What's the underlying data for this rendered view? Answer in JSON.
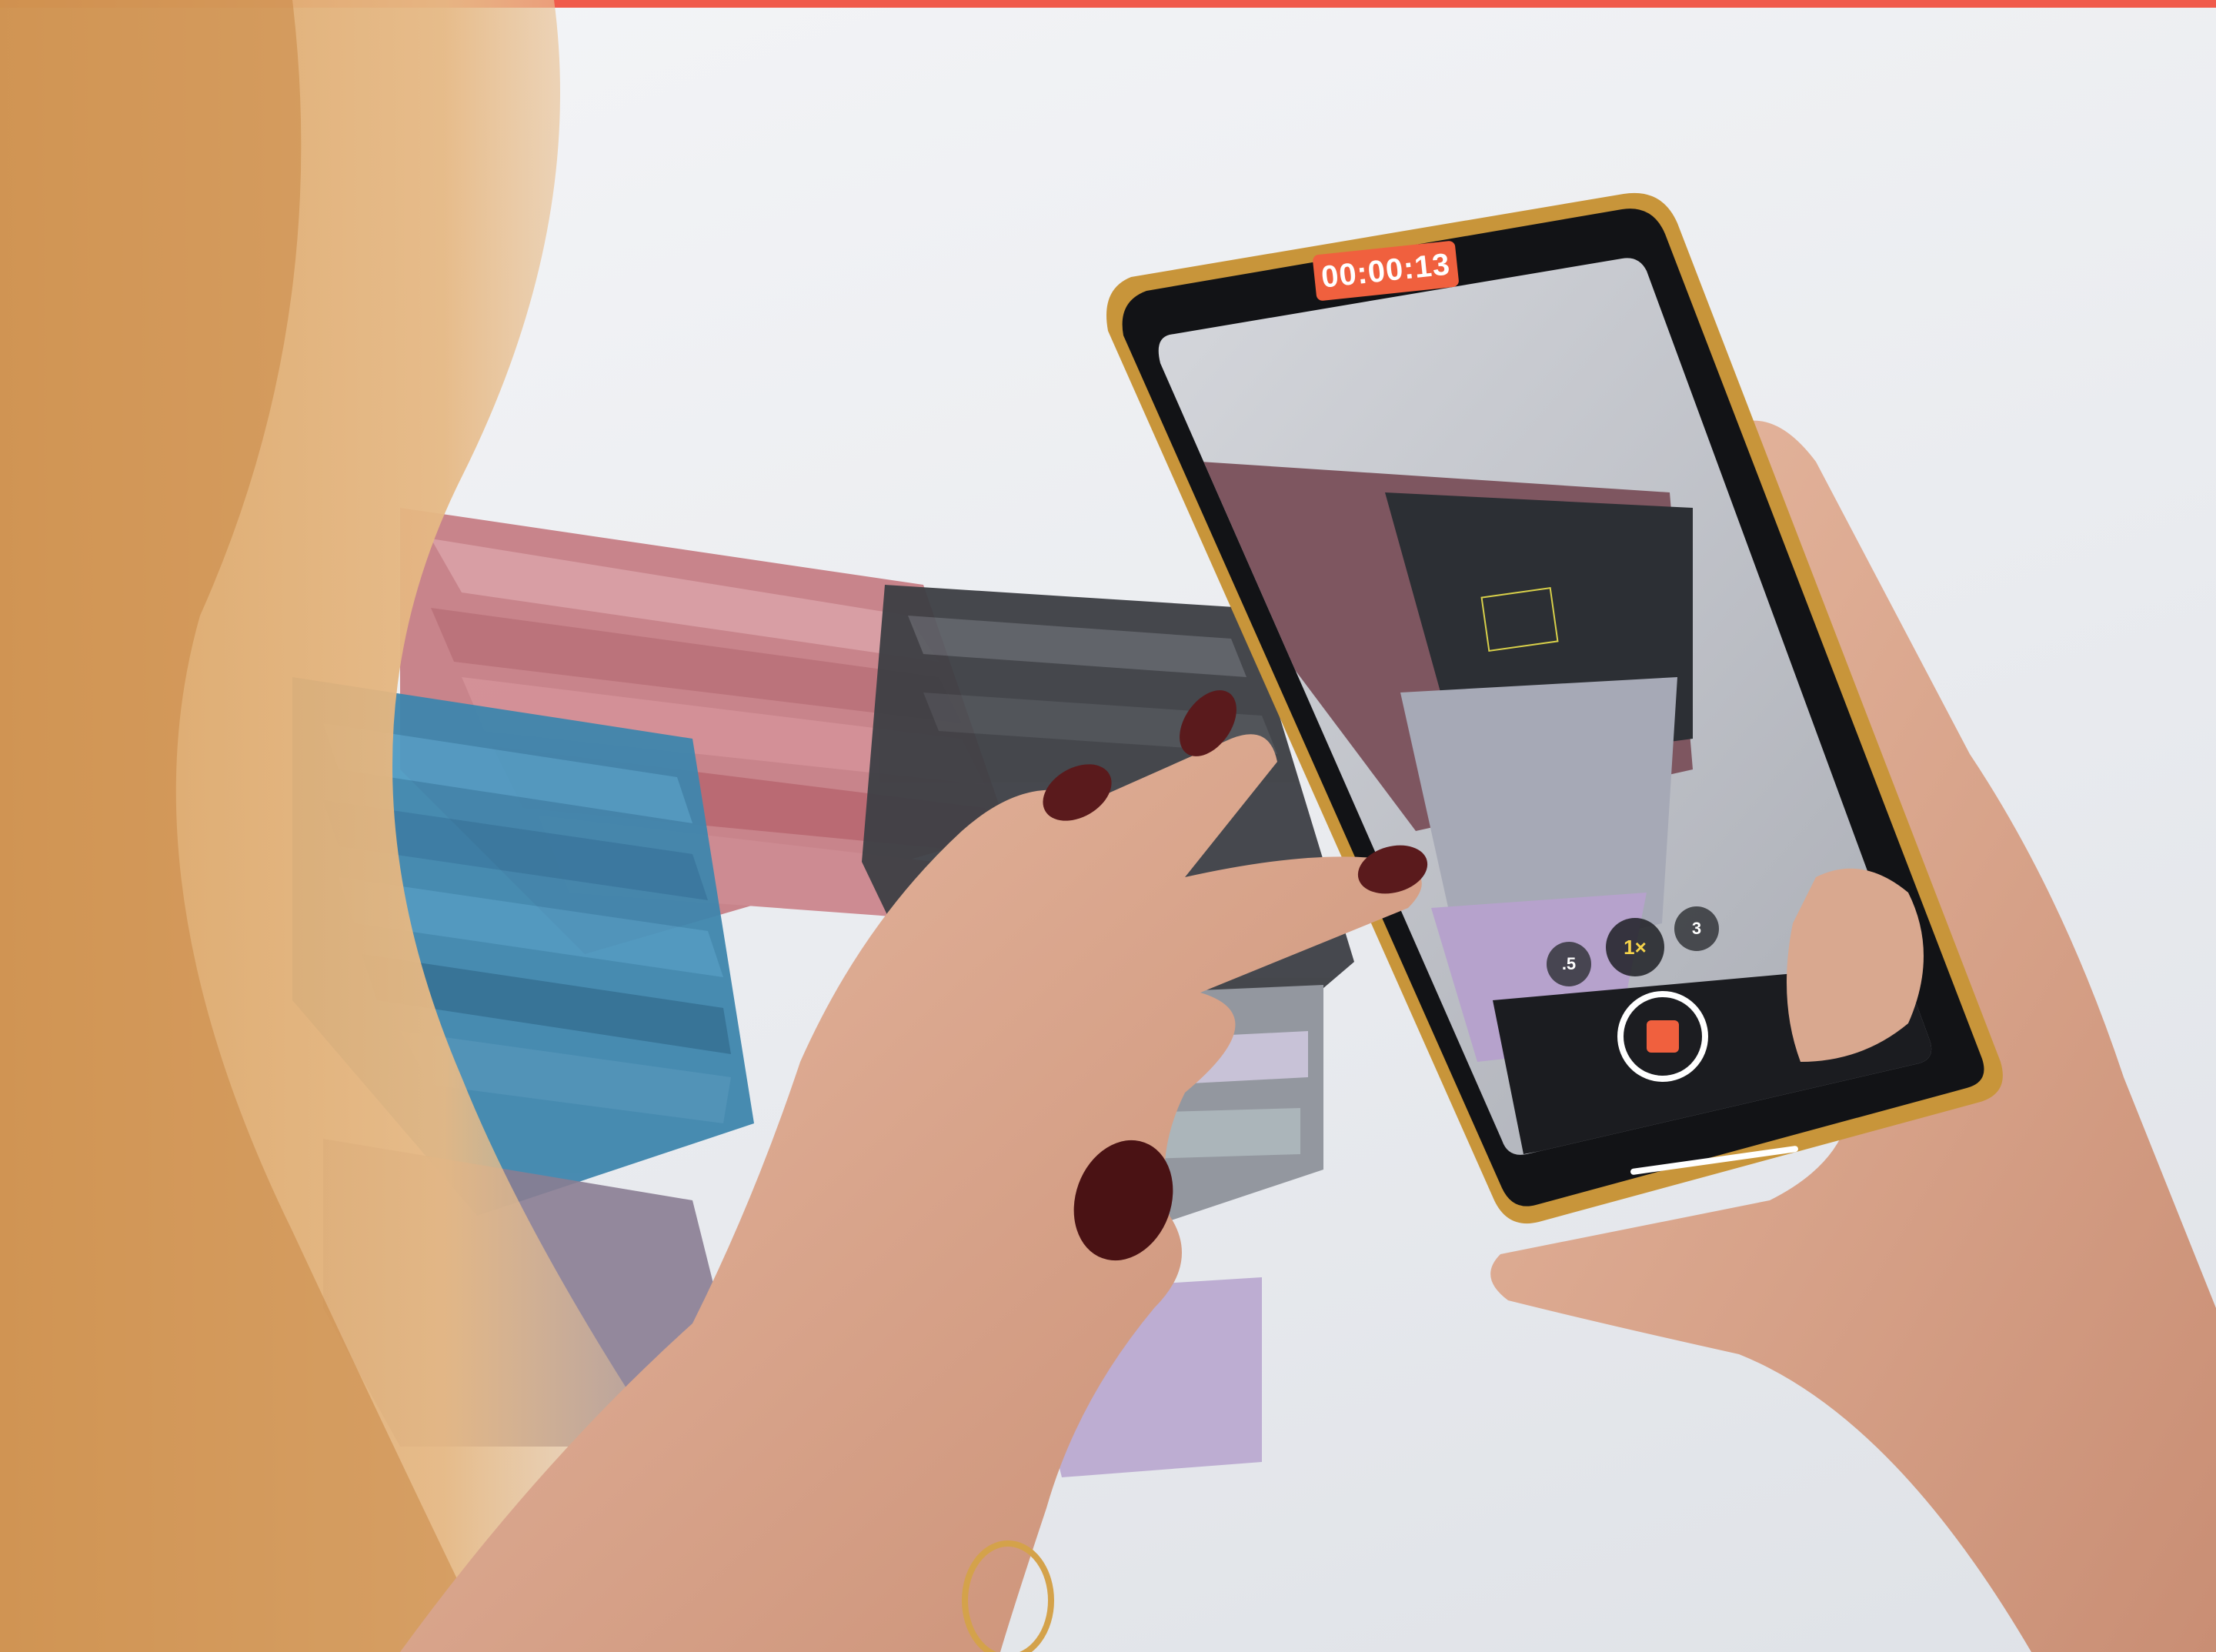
{
  "photo": {
    "subject": "hands holding a smartphone recording video of a pleated fabric garment"
  },
  "camera_ui": {
    "timer": "00:00:13",
    "zoom_options": [
      ".5",
      "1×",
      "3"
    ],
    "active_zoom": "1×"
  },
  "colors": {
    "accent": "#f05a4b",
    "record": "#f0603e",
    "zoom_active": "#f5d34a"
  }
}
